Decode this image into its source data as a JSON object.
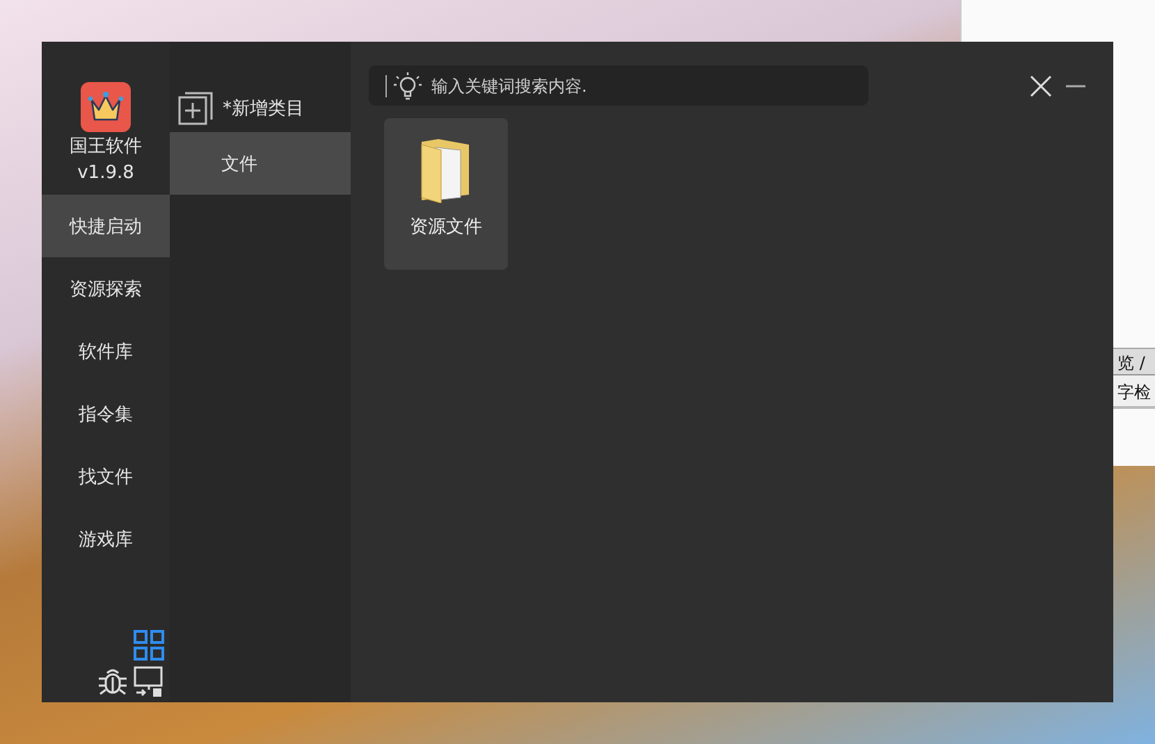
{
  "background_window": {
    "tab_text": "览 /",
    "line_text": "字检"
  },
  "app": {
    "name": "国王软件",
    "version": "v1.9.8"
  },
  "nav": [
    {
      "label": "快捷启动",
      "selected": true
    },
    {
      "label": "资源探索",
      "selected": false
    },
    {
      "label": "软件库",
      "selected": false
    },
    {
      "label": "指令集",
      "selected": false
    },
    {
      "label": "找文件",
      "selected": false
    },
    {
      "label": "游戏库",
      "selected": false
    }
  ],
  "categories": {
    "add_label": "*新增类目",
    "items": [
      {
        "label": "文件",
        "selected": true
      }
    ]
  },
  "search": {
    "placeholder": "输入关键词搜索内容."
  },
  "items": [
    {
      "label": "资源文件"
    }
  ]
}
